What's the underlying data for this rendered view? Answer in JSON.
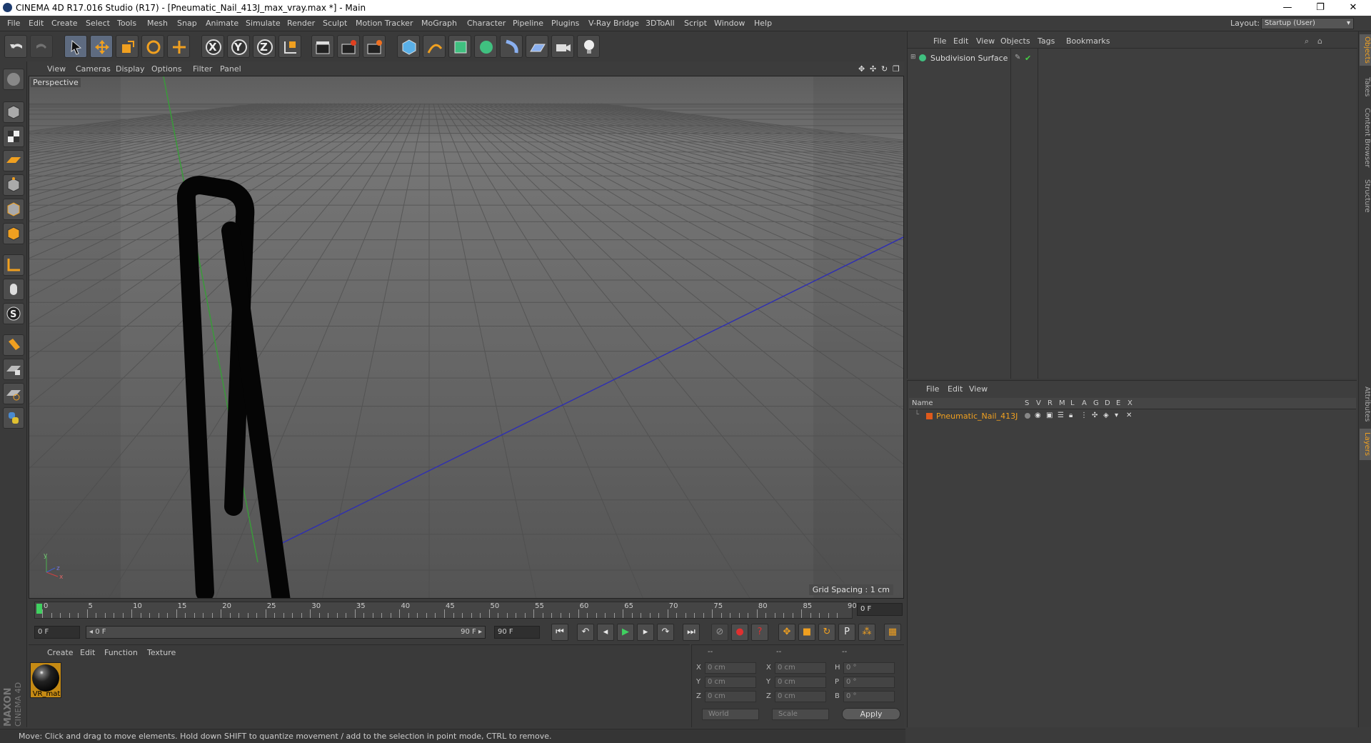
{
  "window": {
    "title": "CINEMA 4D R17.016 Studio (R17) - [Pneumatic_Nail_413J_max_vray.max *] - Main",
    "minimize": "—",
    "maximize": "❐",
    "close": "✕"
  },
  "menubar": {
    "items": [
      "File",
      "Edit",
      "Create",
      "Select",
      "Tools",
      "Mesh",
      "Snap",
      "Animate",
      "Simulate",
      "Render",
      "Sculpt",
      "Motion Tracker",
      "MoGraph",
      "Character",
      "Pipeline",
      "Plugins",
      "V-Ray Bridge",
      "3DToAll",
      "Script",
      "Window",
      "Help"
    ],
    "layout_label": "Layout:",
    "layout_value": "Startup (User)"
  },
  "toolbar": {
    "axis_x": "X",
    "axis_y": "Y",
    "axis_z": "Z"
  },
  "viewport": {
    "menu": [
      "View",
      "Cameras",
      "Display",
      "Options",
      "Filter",
      "Panel"
    ],
    "label": "Perspective",
    "grid_spacing": "Grid Spacing : 1 cm",
    "axis_y_label": "y",
    "axis_x_label": "x",
    "axis_z_label": "z"
  },
  "timeline": {
    "ticks": [
      "0",
      "5",
      "10",
      "15",
      "20",
      "25",
      "30",
      "35",
      "40",
      "45",
      "50",
      "55",
      "60",
      "65",
      "70",
      "75",
      "80",
      "85",
      "90"
    ],
    "current_frame": "0 F"
  },
  "playbar": {
    "start": "0 F",
    "range_start": "◂ 0 F",
    "range_end": "90 F ▸",
    "end": "90 F"
  },
  "materials": {
    "menu": [
      "Create",
      "Edit",
      "Function",
      "Texture"
    ],
    "items": [
      {
        "name": "VR_mat"
      }
    ]
  },
  "coordinates": {
    "header": [
      "--",
      "--",
      "--"
    ],
    "rows": [
      {
        "a": "X",
        "av": "0 cm",
        "b": "X",
        "bv": "0 cm",
        "c": "H",
        "cv": "0 °"
      },
      {
        "a": "Y",
        "av": "0 cm",
        "b": "Y",
        "bv": "0 cm",
        "c": "P",
        "cv": "0 °"
      },
      {
        "a": "Z",
        "av": "0 cm",
        "b": "Z",
        "bv": "0 cm",
        "c": "B",
        "cv": "0 °"
      }
    ],
    "mode": "World",
    "scale": "Scale",
    "apply": "Apply"
  },
  "status": "Move: Click and drag to move elements. Hold down SHIFT to quantize movement / add to the selection in point mode, CTRL to remove.",
  "objects": {
    "menu": [
      "File",
      "Edit",
      "View",
      "Objects",
      "Tags",
      "Bookmarks"
    ],
    "items": [
      {
        "name": "Subdivision Surface"
      }
    ]
  },
  "layers": {
    "menu": [
      "File",
      "Edit",
      "View"
    ],
    "columns": [
      "Name",
      "S",
      "V",
      "R",
      "M",
      "L",
      "A",
      "G",
      "D",
      "E",
      "X"
    ],
    "items": [
      {
        "name": "Pneumatic_Nail_413J",
        "color": "#e05a1c"
      }
    ]
  },
  "side_tabs": [
    "Objects",
    "Takes",
    "Content Browser",
    "Structure",
    "Attributes",
    "Layers"
  ],
  "logo": {
    "line1": "MAXON",
    "line2": "CINEMA 4D"
  },
  "colors": {
    "accent": "#f0a020",
    "layer": "#e05a1c",
    "selection": "#5e6b80"
  }
}
